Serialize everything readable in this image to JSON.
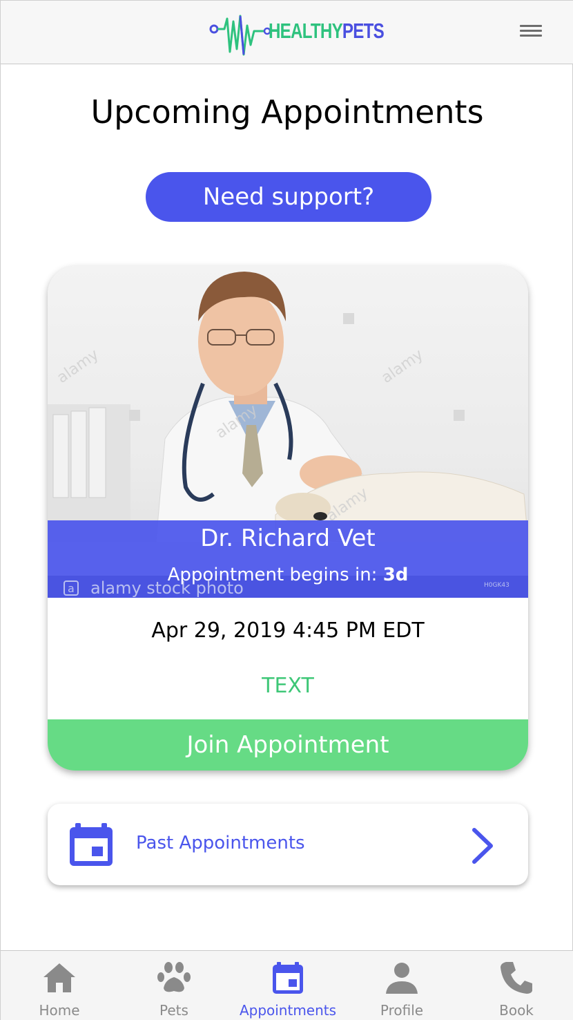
{
  "header": {
    "logo_text_part1": "HEALTHY",
    "logo_text_part2": "PETS"
  },
  "page": {
    "title": "Upcoming Appointments",
    "support_label": "Need support?"
  },
  "appointment": {
    "doctor_name": "Dr. Richard Vet",
    "countdown_prefix": "Appointment begins in:",
    "countdown_value": "3d",
    "date": "Apr 29, 2019 4:45 PM EDT",
    "type": "TEXT",
    "join_label": "Join Appointment",
    "photo_watermark": "alamy stock photo",
    "photo_mark": "a",
    "photo_code": "H0GK43"
  },
  "past": {
    "label": "Past Appointments"
  },
  "nav": {
    "items": [
      {
        "label": "Home",
        "icon": "home-icon"
      },
      {
        "label": "Pets",
        "icon": "paw-icon"
      },
      {
        "label": "Appointments",
        "icon": "calendar-icon",
        "active": true
      },
      {
        "label": "Profile",
        "icon": "person-icon"
      },
      {
        "label": "Book",
        "icon": "phone-icon"
      }
    ]
  },
  "colors": {
    "brand_blue": "#4a55ec",
    "brand_green": "#66db85",
    "text_green": "#3ec777",
    "nav_gray": "#8a8a8a"
  }
}
